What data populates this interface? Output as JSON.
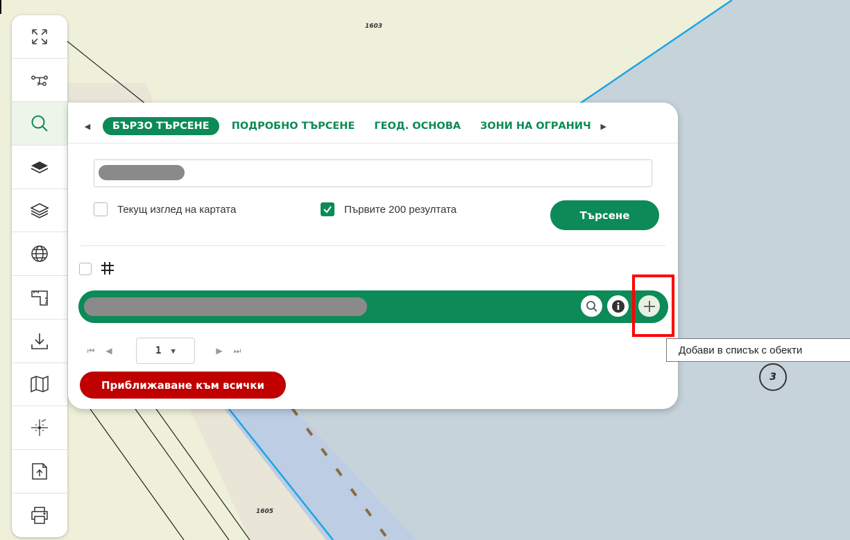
{
  "map": {
    "parcel_labels": [
      "1603",
      "1605"
    ],
    "cluster_count": "3",
    "colors": {
      "land": "#eef0da",
      "water": "#c6d3da",
      "road": "#e9e5d7",
      "channel": "#bccde4",
      "boundary": "#19a5e6"
    }
  },
  "toolbar": {
    "buttons": [
      {
        "icon": "fullscreen-icon"
      },
      {
        "icon": "route-icon"
      },
      {
        "icon": "search-icon",
        "active": true
      },
      {
        "icon": "layers-filled-icon"
      },
      {
        "icon": "layers-outline-icon"
      },
      {
        "icon": "globe-icon"
      },
      {
        "icon": "measure-icon"
      },
      {
        "icon": "download-icon"
      },
      {
        "icon": "map-icon"
      },
      {
        "icon": "coordinates-icon"
      },
      {
        "icon": "upload-file-icon"
      },
      {
        "icon": "print-icon"
      }
    ]
  },
  "search_panel": {
    "tabs": [
      "БЪРЗО ТЪРСЕНЕ",
      "ПОДРОБНО ТЪРСЕНЕ",
      "ГЕОД. ОСНОВА",
      "ЗОНИ НА ОГРАНИЧ"
    ],
    "active_tab": "БЪРЗО ТЪРСЕНЕ",
    "input_value": "",
    "options": {
      "current_view_label": "Текущ изглед на картата",
      "current_view_checked": false,
      "first200_label": "Първите 200 резултата",
      "first200_checked": true
    },
    "search_button": "Търсене",
    "pager": {
      "first": "⏮",
      "prev": "◀",
      "current_page": "1",
      "next": "▶",
      "last": "⏭"
    },
    "zoom_all_button": "Приближаване към всички",
    "accent_color": "#0c8a57",
    "danger_color": "#c00000"
  },
  "tooltip": {
    "text": "Добави в списък с обекти"
  }
}
